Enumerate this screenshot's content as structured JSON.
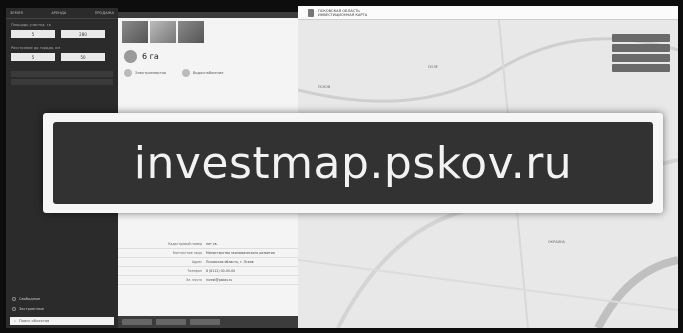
{
  "banner": {
    "text": "investmap.pskov.ru"
  },
  "sidebar": {
    "tabs": [
      "ЗЕМЛЯ",
      "АРЕНДА",
      "ПРОДАЖА"
    ],
    "area_label": "Площадь участка, га",
    "area_from": "5",
    "area_to": "280",
    "dist_label": "Расстояние до города, км",
    "dist_from": "5",
    "dist_to": "50",
    "options": [
      "Свободные",
      "Застроенные"
    ],
    "search_placeholder": "Поиск объектов"
  },
  "panel": {
    "area": "6 га",
    "feature_1": "Электроэнергия",
    "feature_2": "Водоснабжение",
    "info_rows": [
      {
        "k": "Кадастровый номер",
        "v": "нет св."
      },
      {
        "k": "Контактное лицо",
        "v": "Министерство экономического развития"
      },
      {
        "k": "Адрес",
        "v": "Псковская область, г. Псков"
      },
      {
        "k": "Телефон",
        "v": "8 (8112) 00-00-00"
      },
      {
        "k": "Эл. почта",
        "v": "invest@pskov.ru"
      }
    ]
  },
  "map": {
    "brand_line1": "ПСКОВСКАЯ ОБЛАСТЬ",
    "brand_line2": "ИНВЕСТИЦИОННАЯ КАРТА",
    "label_1": "ПОЛЕ",
    "label_2": "ПСКОВ",
    "label_3": "ОКРАИНА"
  }
}
